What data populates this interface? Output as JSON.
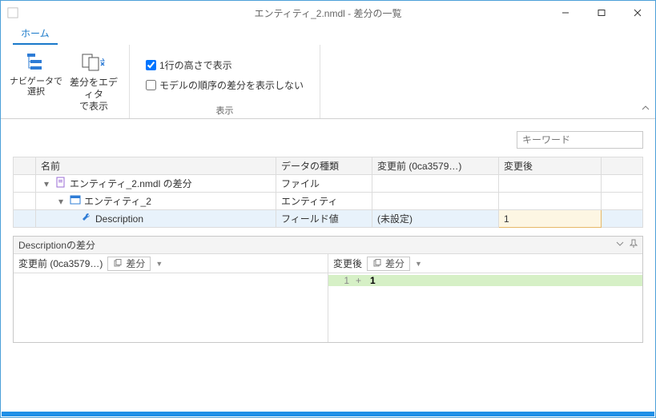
{
  "window": {
    "title": "エンティティ_2.nmdl - 差分の一覧"
  },
  "ribbon": {
    "tab_home": "ホーム",
    "btn_nav_select_l1": "ナビゲータで選択",
    "btn_editor_l1": "差分をエディタ",
    "btn_editor_l2": "で表示",
    "chk_one_line": "1行の高さで表示",
    "chk_hide_order": "モデルの順序の差分を表示しない",
    "group_label": "表示"
  },
  "search": {
    "placeholder": "キーワード"
  },
  "table": {
    "headers": {
      "name": "名前",
      "type": "データの種類",
      "before": "変更前 (0ca3579…)",
      "after": "変更後"
    },
    "rows": [
      {
        "name": "エンティティ_2.nmdl の差分",
        "type": "ファイル",
        "before": "",
        "after": "",
        "level": 0,
        "icon": "doc"
      },
      {
        "name": "エンティティ_2",
        "type": "エンティティ",
        "before": "",
        "after": "",
        "level": 1,
        "icon": "grid"
      },
      {
        "name": "Description",
        "type": "フィールド値",
        "before": "(未設定)",
        "after": "1",
        "level": 2,
        "icon": "wrench",
        "selected": true,
        "hlAfter": true
      }
    ]
  },
  "diff": {
    "title": "Descriptionの差分",
    "left_label": "変更前 (0ca3579…)",
    "right_label": "変更後",
    "chip_label": "差分",
    "add": {
      "ln": "1",
      "pm": "+",
      "text": "1"
    }
  }
}
